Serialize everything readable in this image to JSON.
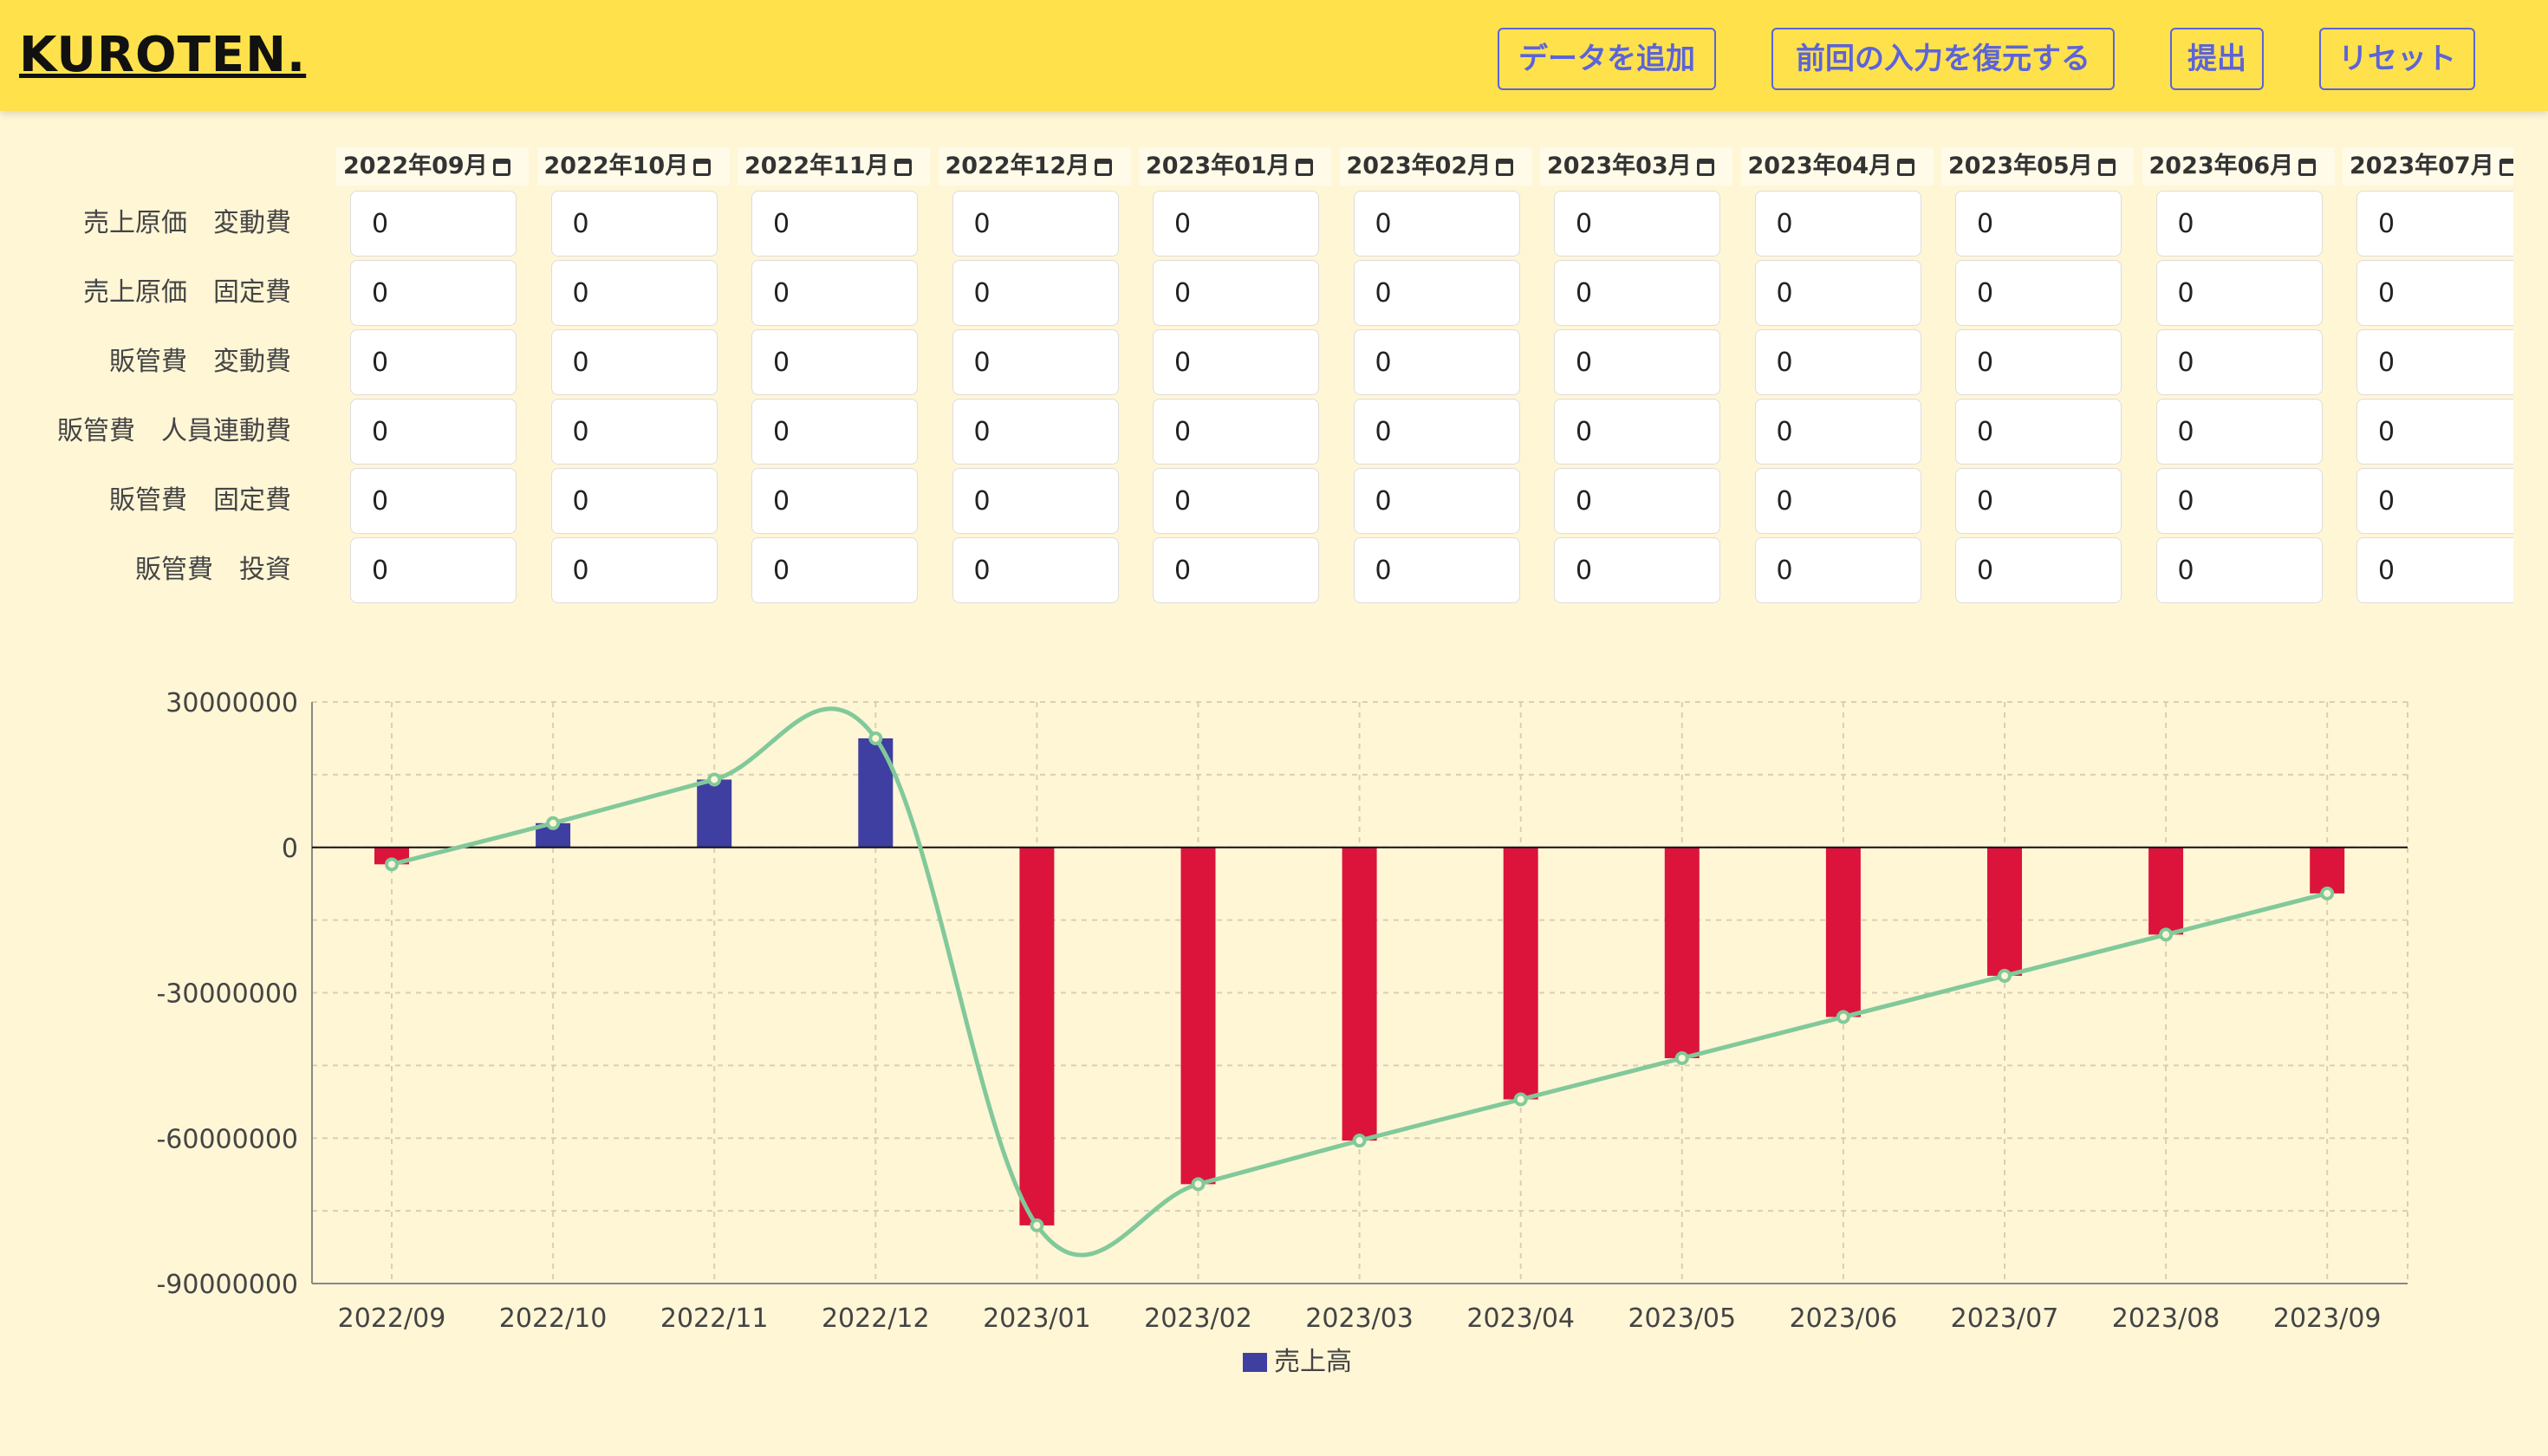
{
  "header": {
    "logo": "KUROTEN.",
    "buttons": [
      {
        "label": "データを追加"
      },
      {
        "label": "前回の入力を復元する"
      },
      {
        "label": "提出"
      },
      {
        "label": "リセット"
      }
    ]
  },
  "table": {
    "months": [
      "2022年09月",
      "2022年10月",
      "2022年11月",
      "2022年12月",
      "2023年01月",
      "2023年02月",
      "2023年03月",
      "2023年04月",
      "2023年05月",
      "2023年06月",
      "2023年07月"
    ],
    "rows": [
      {
        "label": "売上原価　変動費",
        "values": [
          "0",
          "0",
          "0",
          "0",
          "0",
          "0",
          "0",
          "0",
          "0",
          "0",
          "0"
        ]
      },
      {
        "label": "売上原価　固定費",
        "values": [
          "0",
          "0",
          "0",
          "0",
          "0",
          "0",
          "0",
          "0",
          "0",
          "0",
          "0"
        ]
      },
      {
        "label": "販管費　変動費",
        "values": [
          "0",
          "0",
          "0",
          "0",
          "0",
          "0",
          "0",
          "0",
          "0",
          "0",
          "0"
        ]
      },
      {
        "label": "販管費　人員連動費",
        "values": [
          "0",
          "0",
          "0",
          "0",
          "0",
          "0",
          "0",
          "0",
          "0",
          "0",
          "0"
        ]
      },
      {
        "label": "販管費　固定費",
        "values": [
          "0",
          "0",
          "0",
          "0",
          "0",
          "0",
          "0",
          "0",
          "0",
          "0",
          "0"
        ]
      },
      {
        "label": "販管費　投資",
        "values": [
          "0",
          "0",
          "0",
          "0",
          "0",
          "0",
          "0",
          "0",
          "0",
          "0",
          "0"
        ]
      }
    ]
  },
  "chart_data": {
    "type": "bar",
    "categories": [
      "2022/09",
      "2022/10",
      "2022/11",
      "2022/12",
      "2023/01",
      "2023/02",
      "2023/03",
      "2023/04",
      "2023/05",
      "2023/06",
      "2023/07",
      "2023/08",
      "2023/09"
    ],
    "series": [
      {
        "name": "売上高",
        "type": "bar",
        "values": [
          -3500000,
          5000000,
          14000000,
          22500000,
          -78000000,
          -69500000,
          -60500000,
          -52000000,
          -43500000,
          -35000000,
          -26500000,
          -18000000,
          -9500000
        ],
        "positive_color": "#3f3ea1",
        "negative_color": "#dc143c"
      },
      {
        "type": "line",
        "values": [
          -3500000,
          5000000,
          14000000,
          22500000,
          -78000000,
          -69500000,
          -60500000,
          -52000000,
          -43500000,
          -35000000,
          -26500000,
          -18000000,
          -9500000
        ],
        "color": "#82c99a"
      }
    ],
    "y_ticks": [
      "30000000",
      "0",
      "-30000000",
      "-60000000",
      "-90000000"
    ],
    "ylim": [
      -90000000,
      30000000
    ],
    "grid": true,
    "legend": "bottom-center"
  }
}
